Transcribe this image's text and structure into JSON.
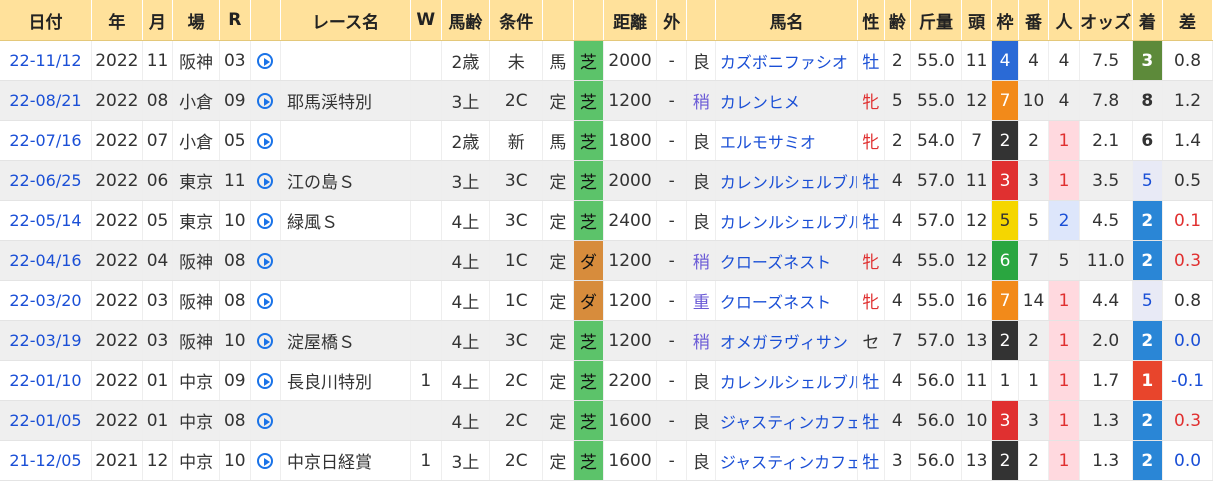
{
  "headers": [
    "日付",
    "年",
    "月",
    "場",
    "R",
    "",
    "レース名",
    "W",
    "馬齢",
    "条件",
    "",
    "",
    "距離",
    "外",
    "",
    "馬名",
    "性",
    "齢",
    "斤量",
    "頭",
    "枠",
    "番",
    "人",
    "オッズ",
    "着",
    "差"
  ],
  "rows": [
    {
      "date": "22-11/12",
      "year": "2022",
      "month": "11",
      "place": "阪神",
      "r": "03",
      "race": "",
      "w": "",
      "age": "2歳",
      "cls": "未",
      "kind": "馬",
      "surf": "芝",
      "surf_type": "turf",
      "dist": "2000",
      "out": "-",
      "cond": "良",
      "horse": "カズボニファシオ",
      "sex": "牡",
      "hage": "2",
      "kin": "55.0",
      "heads": "11",
      "waku": "4",
      "wakuc": "w4",
      "ban": "4",
      "pop": "4",
      "popc": "",
      "odds": "7.5",
      "fin": "3",
      "finc": "fin3",
      "diff": "0.8",
      "diffc": ""
    },
    {
      "date": "22-08/21",
      "year": "2022",
      "month": "08",
      "place": "小倉",
      "r": "09",
      "race": "耶馬渓特別",
      "w": "",
      "age": "3上",
      "cls": "2C",
      "kind": "定",
      "surf": "芝",
      "surf_type": "turf",
      "dist": "1200",
      "out": "-",
      "cond": "稍",
      "horse": "カレンヒメ",
      "sex": "牝",
      "hage": "5",
      "kin": "55.0",
      "heads": "12",
      "waku": "7",
      "wakuc": "w7",
      "ban": "10",
      "pop": "4",
      "popc": "",
      "odds": "7.8",
      "fin": "8",
      "finc": "",
      "diff": "1.2",
      "diffc": ""
    },
    {
      "date": "22-07/16",
      "year": "2022",
      "month": "07",
      "place": "小倉",
      "r": "05",
      "race": "",
      "w": "",
      "age": "2歳",
      "cls": "新",
      "kind": "馬",
      "surf": "芝",
      "surf_type": "turf",
      "dist": "1800",
      "out": "-",
      "cond": "良",
      "horse": "エルモサミオ",
      "sex": "牝",
      "hage": "2",
      "kin": "54.0",
      "heads": "7",
      "waku": "2",
      "wakuc": "w2",
      "ban": "2",
      "pop": "1",
      "popc": "pop1",
      "odds": "2.1",
      "fin": "6",
      "finc": "",
      "diff": "1.4",
      "diffc": ""
    },
    {
      "date": "22-06/25",
      "year": "2022",
      "month": "06",
      "place": "東京",
      "r": "11",
      "race": "江の島Ｓ",
      "w": "",
      "age": "3上",
      "cls": "3C",
      "kind": "定",
      "surf": "芝",
      "surf_type": "turf",
      "dist": "2000",
      "out": "-",
      "cond": "良",
      "horse": "カレンルシェルブル",
      "sex": "牡",
      "hage": "4",
      "kin": "57.0",
      "heads": "11",
      "waku": "3",
      "wakuc": "w3",
      "ban": "3",
      "pop": "1",
      "popc": "pop1",
      "odds": "3.5",
      "fin": "5",
      "finc": "fin5",
      "diff": "0.5",
      "diffc": ""
    },
    {
      "date": "22-05/14",
      "year": "2022",
      "month": "05",
      "place": "東京",
      "r": "10",
      "race": "緑風Ｓ",
      "w": "",
      "age": "4上",
      "cls": "3C",
      "kind": "定",
      "surf": "芝",
      "surf_type": "turf",
      "dist": "2400",
      "out": "-",
      "cond": "良",
      "horse": "カレンルシェルブル",
      "sex": "牡",
      "hage": "4",
      "kin": "57.0",
      "heads": "12",
      "waku": "5",
      "wakuc": "w5",
      "ban": "5",
      "pop": "2",
      "popc": "pop2",
      "odds": "4.5",
      "fin": "2",
      "finc": "fin2",
      "diff": "0.1",
      "diffc": "diff-red"
    },
    {
      "date": "22-04/16",
      "year": "2022",
      "month": "04",
      "place": "阪神",
      "r": "08",
      "race": "",
      "w": "",
      "age": "4上",
      "cls": "1C",
      "kind": "定",
      "surf": "ダ",
      "surf_type": "dirt",
      "dist": "1200",
      "out": "-",
      "cond": "稍",
      "horse": "クローズネスト",
      "sex": "牝",
      "hage": "4",
      "kin": "55.0",
      "heads": "12",
      "waku": "6",
      "wakuc": "w6",
      "ban": "7",
      "pop": "5",
      "popc": "",
      "odds": "11.0",
      "fin": "2",
      "finc": "fin2",
      "diff": "0.3",
      "diffc": "diff-red"
    },
    {
      "date": "22-03/20",
      "year": "2022",
      "month": "03",
      "place": "阪神",
      "r": "08",
      "race": "",
      "w": "",
      "age": "4上",
      "cls": "1C",
      "kind": "定",
      "surf": "ダ",
      "surf_type": "dirt",
      "dist": "1200",
      "out": "-",
      "cond": "重",
      "horse": "クローズネスト",
      "sex": "牝",
      "hage": "4",
      "kin": "55.0",
      "heads": "16",
      "waku": "7",
      "wakuc": "w7",
      "ban": "14",
      "pop": "1",
      "popc": "pop1",
      "odds": "4.4",
      "fin": "5",
      "finc": "fin5",
      "diff": "0.8",
      "diffc": ""
    },
    {
      "date": "22-03/19",
      "year": "2022",
      "month": "03",
      "place": "阪神",
      "r": "10",
      "race": "淀屋橋Ｓ",
      "w": "",
      "age": "4上",
      "cls": "3C",
      "kind": "定",
      "surf": "芝",
      "surf_type": "turf",
      "dist": "1200",
      "out": "-",
      "cond": "稍",
      "horse": "オメガラヴィサン",
      "sex": "セ",
      "hage": "7",
      "kin": "57.0",
      "heads": "13",
      "waku": "2",
      "wakuc": "w2",
      "ban": "2",
      "pop": "1",
      "popc": "pop1",
      "odds": "2.0",
      "fin": "2",
      "finc": "fin2",
      "diff": "0.0",
      "diffc": "diff-blue"
    },
    {
      "date": "22-01/10",
      "year": "2022",
      "month": "01",
      "place": "中京",
      "r": "09",
      "race": "長良川特別",
      "w": "1",
      "age": "4上",
      "cls": "2C",
      "kind": "定",
      "surf": "芝",
      "surf_type": "turf",
      "dist": "2200",
      "out": "-",
      "cond": "良",
      "horse": "カレンルシェルブル",
      "sex": "牡",
      "hage": "4",
      "kin": "56.0",
      "heads": "11",
      "waku": "1",
      "wakuc": "w1",
      "ban": "1",
      "pop": "1",
      "popc": "pop1",
      "odds": "1.7",
      "fin": "1",
      "finc": "fin1",
      "diff": "-0.1",
      "diffc": "diff-blue"
    },
    {
      "date": "22-01/05",
      "year": "2022",
      "month": "01",
      "place": "中京",
      "r": "08",
      "race": "",
      "w": "",
      "age": "4上",
      "cls": "2C",
      "kind": "定",
      "surf": "芝",
      "surf_type": "turf",
      "dist": "1600",
      "out": "-",
      "cond": "良",
      "horse": "ジャスティンカフェ",
      "sex": "牡",
      "hage": "4",
      "kin": "56.0",
      "heads": "10",
      "waku": "3",
      "wakuc": "w3",
      "ban": "3",
      "pop": "1",
      "popc": "pop1",
      "odds": "1.3",
      "fin": "2",
      "finc": "fin2",
      "diff": "0.3",
      "diffc": "diff-red"
    },
    {
      "date": "21-12/05",
      "year": "2021",
      "month": "12",
      "place": "中京",
      "r": "10",
      "race": "中京日経賞",
      "w": "1",
      "age": "3上",
      "cls": "2C",
      "kind": "定",
      "surf": "芝",
      "surf_type": "turf",
      "dist": "1600",
      "out": "-",
      "cond": "良",
      "horse": "ジャスティンカフェ",
      "sex": "牡",
      "hage": "3",
      "kin": "56.0",
      "heads": "13",
      "waku": "2",
      "wakuc": "w2",
      "ban": "2",
      "pop": "1",
      "popc": "pop1",
      "odds": "1.3",
      "fin": "2",
      "finc": "fin2",
      "diff": "0.0",
      "diffc": "diff-blue"
    }
  ]
}
